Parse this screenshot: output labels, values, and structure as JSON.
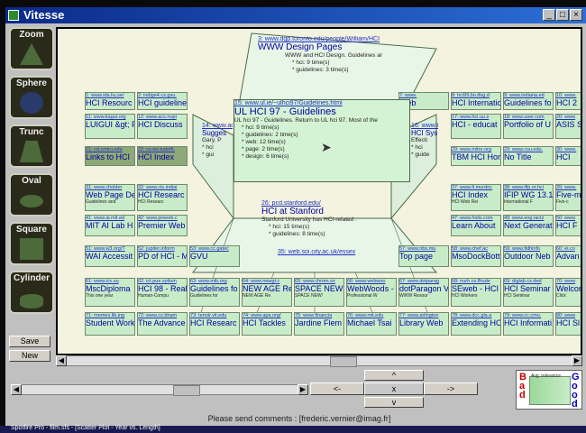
{
  "window": {
    "title": "Vitesse"
  },
  "tools": [
    {
      "label": "Zoom"
    },
    {
      "label": "Sphere"
    },
    {
      "label": "Trunc"
    },
    {
      "label": "Oval"
    },
    {
      "label": "Square"
    },
    {
      "label": "Cylinder"
    }
  ],
  "buttons": {
    "save": "Save",
    "new": "New"
  },
  "top_node": {
    "url": "3: www.dgp.toronto.edu/people/William/HCI",
    "title": "WWW Design Pages",
    "desc": [
      "WWW and HCI Design. Guidelines ar",
      "* hci: 9 time(s)",
      "* guidelines: 3 time(s)"
    ]
  },
  "focus_node": {
    "url": "15: www.ul.ie/~ulhci97/Guidelines.html",
    "title": "UL HCI 97 - Guidelines",
    "desc": [
      "UL hci 97 - Guidelines. Return to UL hci 97. Most of the",
      "* hci: 9 time(s)",
      "* guidelines: 2 time(s)",
      "* web: 12 time(s)",
      "* page: 2 time(s)",
      "* design: 6 time(s)"
    ]
  },
  "stanford_node": {
    "url": "26: pcd.stanford.edu/",
    "title": "HCI at Stanford",
    "desc": [
      "Stanford University has HCI-related :",
      "* hci: 15 time(s)",
      "* guidelines: 8 time(s)"
    ]
  },
  "essex_node": {
    "url": "35: web.soi.city.ac.uk/essex"
  },
  "side_left": {
    "url": "14: www.ac.",
    "title": "Sugges",
    "desc": [
      "Gary. P",
      "* hci",
      "* gui"
    ]
  },
  "side_right": {
    "url": "16: www.bri",
    "title": "HCI Sys",
    "desc": [
      "Effecti",
      "* hci",
      "* guide"
    ]
  },
  "rows": [
    [
      {
        "u": "1: www.ida.liu.se/",
        "t": "HCI Resourc"
      },
      {
        "u": "2: indige4.cs.gsu.",
        "t": "HCI guideline"
      },
      {
        "u": "7: www.",
        "t": "Web"
      },
      {
        "u": "8: hci99.bo.tfsg.d",
        "t": "HCI Internatic"
      },
      {
        "u": "9: www.indiana.ed",
        "t": "Guidelines fo"
      },
      {
        "u": "10: www.",
        "t": "HCI 2"
      }
    ],
    [
      {
        "u": "11: www.kagui.org",
        "t": "LUIGUI &gt; F"
      },
      {
        "u": "12: www.acs.nupi",
        "t": "HCI Discuss"
      },
      {
        "u": "17: www.hci.uu.s",
        "t": "HCI - educat"
      },
      {
        "u": "18: www.user.com",
        "t": "Portfolio of U"
      },
      {
        "u": "20: www",
        "t": "ASIS S"
      }
    ],
    [
      {
        "u": "21: cd.cmiru.edu",
        "t": "Links to HCI",
        "sel": true
      },
      {
        "u": "22: cs.twi.tudelft.",
        "t": "HCI Index",
        "sel": true
      },
      {
        "u": "29: www.mitre.org",
        "t": "TBM HCI Hor"
      },
      {
        "u": "29: www.csu.edu.",
        "t": "No Title"
      },
      {
        "u": "30: www.",
        "t": "HCI"
      }
    ],
    [
      {
        "u": "31: www.cholder",
        "t": "Web Page De",
        "d": "Guidelines and"
      },
      {
        "u": "32: www.cis.indiai",
        "t": "HCI Researc",
        "d": "HCI Researc"
      },
      {
        "u": "37: www.lt.murdoc",
        "t": "HCI Index",
        "d": "HCI Web Rei"
      },
      {
        "u": "38: www.ifip.or.hci",
        "t": "IFIP WG 13.1",
        "d": "International F"
      },
      {
        "u": "39: www.",
        "t": "Five-m",
        "d": "Five-c"
      }
    ],
    [
      {
        "u": "41: www.ai.mit.ed",
        "t": "MIT AI Lab H"
      },
      {
        "u": "42: www.preeeb.c",
        "t": "Premier Web"
      },
      {
        "u": "47: www.holis.com",
        "t": "Learn About"
      },
      {
        "u": "49: www.eng.lactz",
        "t": "Next Generat"
      },
      {
        "u": "50: www",
        "t": "HCI F"
      }
    ],
    [
      {
        "u": "51: www.w3.org/T",
        "t": "WAI Accessit"
      },
      {
        "u": "52: jupiter.inform",
        "t": "PD of HCI - M"
      },
      {
        "u": "53: www.cc.gatec",
        "t": "GVU"
      },
      {
        "u": "57: www.nbs.mu",
        "t": "Top page"
      },
      {
        "u": "58: www.chef.ac",
        "t": "MsoDockBott"
      },
      {
        "u": "59: www.fidhinfo",
        "t": "Outdoor Neb"
      },
      {
        "u": "60: ei.co",
        "t": "Advan"
      }
    ],
    [
      {
        "u": "61: www.ics.uu",
        "t": "MscDiploma",
        "d": "This one year"
      },
      {
        "u": "62: ict.pue.sytlum",
        "t": "HCI 98 - Real",
        "d": "Human-Compu"
      },
      {
        "u": "63: www.mib.org",
        "t": "Guidelines fo",
        "d": "Guidelines for"
      },
      {
        "u": "64: www.newgt.c",
        "t": "NEW AGE Re",
        "d": "NEW AGE Re"
      },
      {
        "u": "65: www.chrom.oz",
        "t": "SPACE NEW!",
        "d": "SPACE NEW!"
      },
      {
        "u": "66: www.webwoo",
        "t": "WebWoods -",
        "d": "Professional W"
      },
      {
        "u": "67: www.dotparag",
        "t": "dotParagon V",
        "d": "WWW Resour"
      },
      {
        "u": "68: nurh.cs.ffrude",
        "t": "SEweb - HCI",
        "d": "HCI Workers"
      },
      {
        "u": "69: diglab.cs.ded",
        "t": "HCI Seminar",
        "d": "HCI Seminar"
      },
      {
        "u": "70: www",
        "t": "Welcom",
        "d": "Click"
      }
    ],
    [
      {
        "u": "71: memex.lib.ing",
        "t": "Student Work"
      },
      {
        "u": "72: www.cs.bham",
        "t": "The Advance"
      },
      {
        "u": "73: tenoir.vit.edu",
        "t": "HCI Researc"
      },
      {
        "u": "74: www.apa.org/",
        "t": "HCI Tackles"
      },
      {
        "u": "75: www.financia",
        "t": "Jardine Flem"
      },
      {
        "u": "76: www.mit.edu",
        "t": "Michael Tsai"
      },
      {
        "u": "77: www.arlington",
        "t": "Library Web"
      },
      {
        "u": "78: www.dcc.gla.a",
        "t": "Extending HC"
      },
      {
        "u": "79: www.cc.cmu.",
        "t": "HCI Informati"
      },
      {
        "u": "80: www",
        "t": "HCI Sl"
      }
    ]
  ],
  "nav": {
    "left": "<-",
    "right": "->",
    "up": "^",
    "down": "v",
    "center": "x"
  },
  "legend": {
    "bad": "Bad",
    "good": "Good",
    "label": "Avg. relevance"
  },
  "status": "Please send comments : [frederic.vernier@imag.fr]",
  "taskbar": "Spotfire Pro - film.sfs - [Scatter Plot - Year vs. Length]"
}
